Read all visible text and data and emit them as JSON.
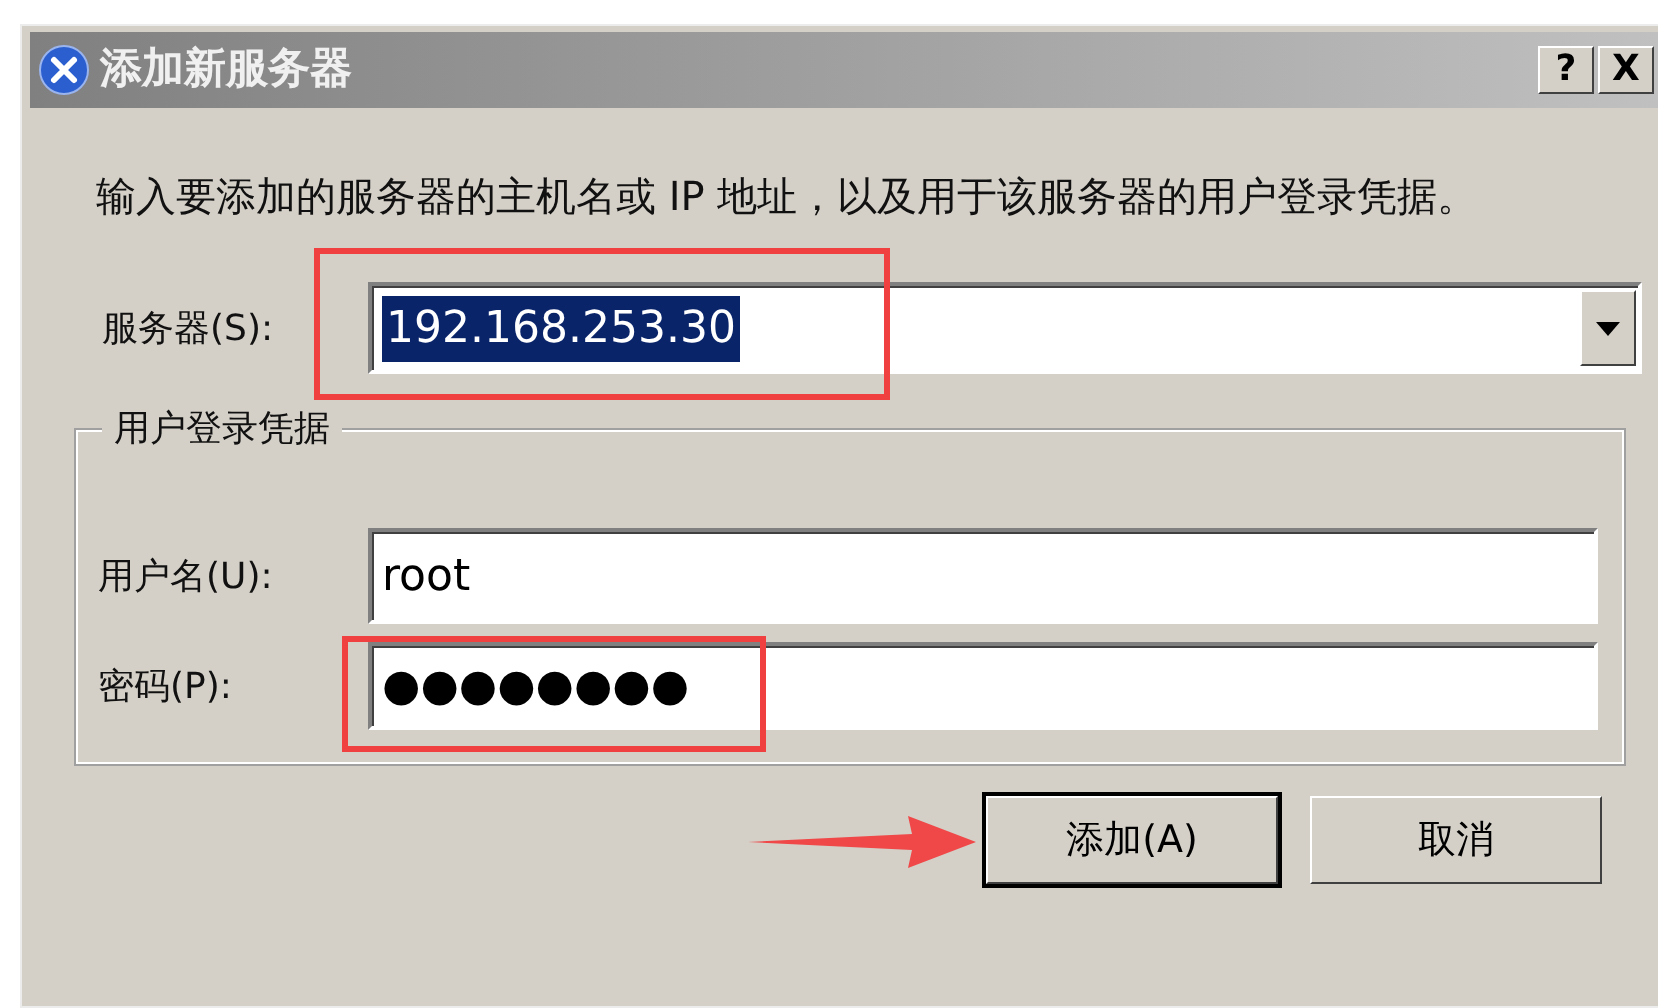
{
  "window": {
    "title": "添加新服务器",
    "title_buttons": [
      "?",
      "X"
    ]
  },
  "description": "输入要添加的服务器的主机名或 IP 地址，以及用于该服务器的用户登录凭据。",
  "server": {
    "label": "服务器(S):",
    "value": "192.168.253.30",
    "selected": true,
    "kind": "combo"
  },
  "credentials": {
    "title": "用户登录凭据",
    "fields": [
      {
        "label": "用户名(U):",
        "value": "root"
      },
      {
        "label": "密码(P):",
        "value": "●●●●●●●●"
      }
    ]
  },
  "buttons": [
    {
      "label": "添加(A)",
      "default": true
    },
    {
      "label": "取消",
      "default": false
    }
  ],
  "annotations": [
    {
      "kind": "box"
    },
    {
      "kind": "box"
    },
    {
      "kind": "arrow"
    }
  ]
}
